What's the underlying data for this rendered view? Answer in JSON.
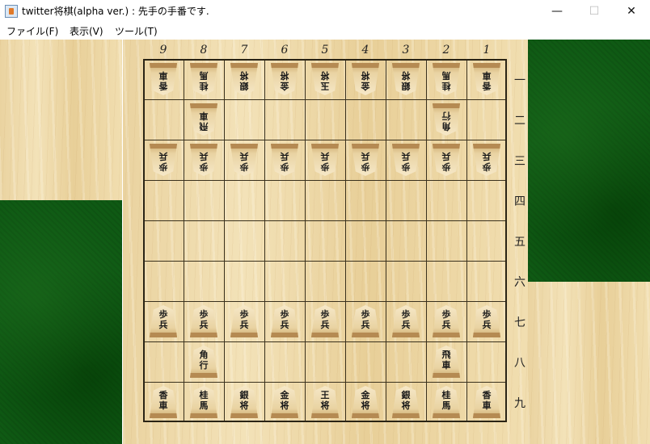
{
  "window": {
    "title": "twitter将棋(alpha ver.) : 先手の手番です.",
    "minimize": "—",
    "maximize": "☐",
    "close": "✕"
  },
  "menu": [
    {
      "label": "ファイル(F)"
    },
    {
      "label": "表示(V)"
    },
    {
      "label": "ツール(T)"
    }
  ],
  "board": {
    "column_labels": [
      "9",
      "8",
      "7",
      "6",
      "5",
      "4",
      "3",
      "2",
      "1"
    ],
    "row_labels": [
      "一",
      "二",
      "三",
      "四",
      "五",
      "六",
      "七",
      "八",
      "九"
    ],
    "pieces": [
      {
        "side": "gote",
        "file": 9,
        "rank": 1,
        "label": "香\n車"
      },
      {
        "side": "gote",
        "file": 8,
        "rank": 1,
        "label": "桂\n馬"
      },
      {
        "side": "gote",
        "file": 7,
        "rank": 1,
        "label": "銀\n将"
      },
      {
        "side": "gote",
        "file": 6,
        "rank": 1,
        "label": "金\n将"
      },
      {
        "side": "gote",
        "file": 5,
        "rank": 1,
        "label": "玉\n将"
      },
      {
        "side": "gote",
        "file": 4,
        "rank": 1,
        "label": "金\n将"
      },
      {
        "side": "gote",
        "file": 3,
        "rank": 1,
        "label": "銀\n将"
      },
      {
        "side": "gote",
        "file": 2,
        "rank": 1,
        "label": "桂\n馬"
      },
      {
        "side": "gote",
        "file": 1,
        "rank": 1,
        "label": "香\n車"
      },
      {
        "side": "gote",
        "file": 8,
        "rank": 2,
        "label": "飛\n車"
      },
      {
        "side": "gote",
        "file": 2,
        "rank": 2,
        "label": "角\n行"
      },
      {
        "side": "gote",
        "file": 9,
        "rank": 3,
        "label": "歩\n兵"
      },
      {
        "side": "gote",
        "file": 8,
        "rank": 3,
        "label": "歩\n兵"
      },
      {
        "side": "gote",
        "file": 7,
        "rank": 3,
        "label": "歩\n兵"
      },
      {
        "side": "gote",
        "file": 6,
        "rank": 3,
        "label": "歩\n兵"
      },
      {
        "side": "gote",
        "file": 5,
        "rank": 3,
        "label": "歩\n兵"
      },
      {
        "side": "gote",
        "file": 4,
        "rank": 3,
        "label": "歩\n兵"
      },
      {
        "side": "gote",
        "file": 3,
        "rank": 3,
        "label": "歩\n兵"
      },
      {
        "side": "gote",
        "file": 2,
        "rank": 3,
        "label": "歩\n兵"
      },
      {
        "side": "gote",
        "file": 1,
        "rank": 3,
        "label": "歩\n兵"
      },
      {
        "side": "sente",
        "file": 9,
        "rank": 7,
        "label": "歩\n兵"
      },
      {
        "side": "sente",
        "file": 8,
        "rank": 7,
        "label": "歩\n兵"
      },
      {
        "side": "sente",
        "file": 7,
        "rank": 7,
        "label": "歩\n兵"
      },
      {
        "side": "sente",
        "file": 6,
        "rank": 7,
        "label": "歩\n兵"
      },
      {
        "side": "sente",
        "file": 5,
        "rank": 7,
        "label": "歩\n兵"
      },
      {
        "side": "sente",
        "file": 4,
        "rank": 7,
        "label": "歩\n兵"
      },
      {
        "side": "sente",
        "file": 3,
        "rank": 7,
        "label": "歩\n兵"
      },
      {
        "side": "sente",
        "file": 2,
        "rank": 7,
        "label": "歩\n兵"
      },
      {
        "side": "sente",
        "file": 1,
        "rank": 7,
        "label": "歩\n兵"
      },
      {
        "side": "sente",
        "file": 8,
        "rank": 8,
        "label": "角\n行"
      },
      {
        "side": "sente",
        "file": 2,
        "rank": 8,
        "label": "飛\n車"
      },
      {
        "side": "sente",
        "file": 9,
        "rank": 9,
        "label": "香\n車"
      },
      {
        "side": "sente",
        "file": 8,
        "rank": 9,
        "label": "桂\n馬"
      },
      {
        "side": "sente",
        "file": 7,
        "rank": 9,
        "label": "銀\n将"
      },
      {
        "side": "sente",
        "file": 6,
        "rank": 9,
        "label": "金\n将"
      },
      {
        "side": "sente",
        "file": 5,
        "rank": 9,
        "label": "王\n将"
      },
      {
        "side": "sente",
        "file": 4,
        "rank": 9,
        "label": "金\n将"
      },
      {
        "side": "sente",
        "file": 3,
        "rank": 9,
        "label": "銀\n将"
      },
      {
        "side": "sente",
        "file": 2,
        "rank": 9,
        "label": "桂\n馬"
      },
      {
        "side": "sente",
        "file": 1,
        "rank": 9,
        "label": "香\n車"
      }
    ]
  }
}
